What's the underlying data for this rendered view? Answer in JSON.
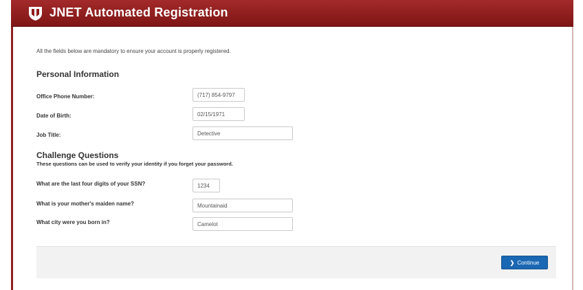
{
  "header": {
    "title": "JNET Automated Registration",
    "logo_icon": "jnet-shield-logo"
  },
  "intro": "All the fields below are mandatory to ensure your account is properly registered.",
  "personal": {
    "title": "Personal Information",
    "fields": [
      {
        "label": "Office Phone Number:",
        "value": "(717) 854-9797"
      },
      {
        "label": "Date of Birth:",
        "value": "02/15/1971"
      },
      {
        "label": "Job Title:",
        "value": "Detective"
      }
    ]
  },
  "challenge": {
    "title": "Challenge Questions",
    "subtitle": "These questions can be used to verify your identity if you forget your password.",
    "fields": [
      {
        "label": "What are the last four digits of your SSN?",
        "value": "1234"
      },
      {
        "label": "What is your mother's maiden name?",
        "value": "Mountainaid"
      },
      {
        "label": "What city were you born in?",
        "value": "Camelot"
      }
    ]
  },
  "footer": {
    "continue_label": "Continue",
    "continue_icon": "chevron-right-icon"
  },
  "colors": {
    "header": "#8f1d1d",
    "button": "#1a67b3"
  }
}
